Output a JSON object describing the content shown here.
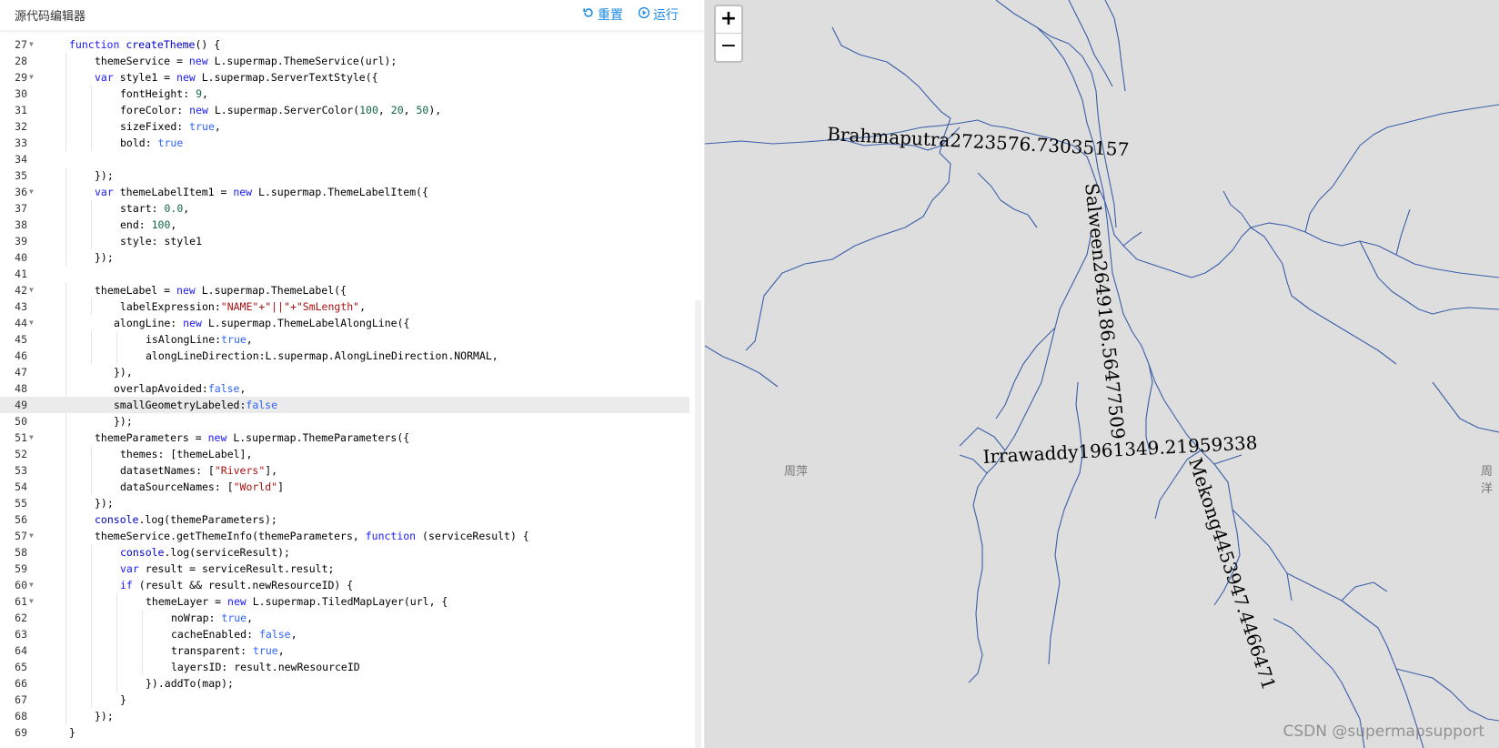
{
  "editor": {
    "title": "源代码编辑器",
    "reset_label": "重置",
    "run_label": "运行",
    "active_line": 49,
    "lines": [
      {
        "n": "27",
        "fold": true,
        "indent": 1,
        "segs": [
          [
            "kw",
            "function "
          ],
          [
            "fn",
            "createTheme"
          ],
          [
            "",
            "() {"
          ]
        ]
      },
      {
        "n": "28",
        "fold": false,
        "indent": 2,
        "segs": [
          [
            "",
            "themeService = "
          ],
          [
            "kw",
            "new "
          ],
          [
            "",
            "L.supermap.ThemeService(url);"
          ]
        ]
      },
      {
        "n": "29",
        "fold": true,
        "indent": 2,
        "segs": [
          [
            "kw",
            "var "
          ],
          [
            "",
            "style1 = "
          ],
          [
            "kw",
            "new "
          ],
          [
            "",
            "L.supermap.ServerTextStyle({"
          ]
        ]
      },
      {
        "n": "30",
        "fold": false,
        "indent": 3,
        "segs": [
          [
            "",
            "fontHeight: "
          ],
          [
            "num",
            "9"
          ],
          [
            "",
            ","
          ]
        ]
      },
      {
        "n": "31",
        "fold": false,
        "indent": 3,
        "segs": [
          [
            "",
            "foreColor: "
          ],
          [
            "kw",
            "new "
          ],
          [
            "",
            "L.supermap.ServerColor("
          ],
          [
            "num",
            "100"
          ],
          [
            "",
            ", "
          ],
          [
            "num",
            "20"
          ],
          [
            "",
            ", "
          ],
          [
            "num",
            "50"
          ],
          [
            "",
            "),"
          ]
        ]
      },
      {
        "n": "32",
        "fold": false,
        "indent": 3,
        "segs": [
          [
            "",
            "sizeFixed: "
          ],
          [
            "lit",
            "true"
          ],
          [
            "",
            ","
          ]
        ]
      },
      {
        "n": "33",
        "fold": false,
        "indent": 3,
        "segs": [
          [
            "",
            "bold: "
          ],
          [
            "lit",
            "true"
          ]
        ]
      },
      {
        "n": "34",
        "fold": false,
        "indent": 0,
        "segs": []
      },
      {
        "n": "35",
        "fold": false,
        "indent": 2,
        "segs": [
          [
            "",
            "});"
          ]
        ]
      },
      {
        "n": "36",
        "fold": true,
        "indent": 2,
        "segs": [
          [
            "kw",
            "var "
          ],
          [
            "",
            "themeLabelItem1 = "
          ],
          [
            "kw",
            "new "
          ],
          [
            "",
            "L.supermap.ThemeLabelItem({"
          ]
        ]
      },
      {
        "n": "37",
        "fold": false,
        "indent": 3,
        "segs": [
          [
            "",
            "start: "
          ],
          [
            "num",
            "0.0"
          ],
          [
            "",
            ","
          ]
        ]
      },
      {
        "n": "38",
        "fold": false,
        "indent": 3,
        "segs": [
          [
            "",
            "end: "
          ],
          [
            "num",
            "100"
          ],
          [
            "",
            ","
          ]
        ]
      },
      {
        "n": "39",
        "fold": false,
        "indent": 3,
        "segs": [
          [
            "",
            "style: style1"
          ]
        ]
      },
      {
        "n": "40",
        "fold": false,
        "indent": 2,
        "segs": [
          [
            "",
            "});"
          ]
        ]
      },
      {
        "n": "41",
        "fold": false,
        "indent": 0,
        "segs": []
      },
      {
        "n": "42",
        "fold": true,
        "indent": 2,
        "segs": [
          [
            "",
            "themeLabel = "
          ],
          [
            "kw",
            "new "
          ],
          [
            "",
            "L.supermap.ThemeLabel({"
          ]
        ]
      },
      {
        "n": "43",
        "fold": false,
        "indent": 3,
        "segs": [
          [
            "",
            "labelExpression:"
          ],
          [
            "str",
            "\"NAME\"+\"||\"+\"SmLength\""
          ],
          [
            "",
            ","
          ]
        ]
      },
      {
        "n": "44",
        "fold": true,
        "indent": 2.75,
        "segs": [
          [
            "",
            "alongLine: "
          ],
          [
            "kw",
            "new "
          ],
          [
            "",
            "L.supermap.ThemeLabelAlongLine({"
          ]
        ]
      },
      {
        "n": "45",
        "fold": false,
        "indent": 4,
        "segs": [
          [
            "",
            "isAlongLine:"
          ],
          [
            "lit",
            "true"
          ],
          [
            "",
            ","
          ]
        ]
      },
      {
        "n": "46",
        "fold": false,
        "indent": 4,
        "segs": [
          [
            "",
            "alongLineDirection:L.supermap.AlongLineDirection.NORMAL,"
          ]
        ]
      },
      {
        "n": "47",
        "fold": false,
        "indent": 2.75,
        "segs": [
          [
            "",
            "}),"
          ]
        ]
      },
      {
        "n": "48",
        "fold": false,
        "indent": 2.75,
        "segs": [
          [
            "",
            "overlapAvoided:"
          ],
          [
            "lit",
            "false"
          ],
          [
            "",
            ","
          ]
        ]
      },
      {
        "n": "49",
        "fold": false,
        "indent": 2.75,
        "segs": [
          [
            "",
            "smallGeometryLabeled:"
          ],
          [
            "lit",
            "false"
          ]
        ]
      },
      {
        "n": "50",
        "fold": false,
        "indent": 2.75,
        "segs": [
          [
            "",
            "});"
          ]
        ]
      },
      {
        "n": "51",
        "fold": true,
        "indent": 2,
        "segs": [
          [
            "",
            "themeParameters = "
          ],
          [
            "kw",
            "new "
          ],
          [
            "",
            "L.supermap.ThemeParameters({"
          ]
        ]
      },
      {
        "n": "52",
        "fold": false,
        "indent": 3,
        "segs": [
          [
            "",
            "themes: [themeLabel],"
          ]
        ]
      },
      {
        "n": "53",
        "fold": false,
        "indent": 3,
        "segs": [
          [
            "",
            "datasetNames: ["
          ],
          [
            "str",
            "\"Rivers\""
          ],
          [
            "",
            "],"
          ]
        ]
      },
      {
        "n": "54",
        "fold": false,
        "indent": 3,
        "segs": [
          [
            "",
            "dataSourceNames: ["
          ],
          [
            "str",
            "\"World\""
          ],
          [
            "",
            "]"
          ]
        ]
      },
      {
        "n": "55",
        "fold": false,
        "indent": 2,
        "segs": [
          [
            "",
            "});"
          ]
        ]
      },
      {
        "n": "56",
        "fold": false,
        "indent": 2,
        "segs": [
          [
            "fn",
            "console"
          ],
          [
            "",
            ".log(themeParameters);"
          ]
        ]
      },
      {
        "n": "57",
        "fold": true,
        "indent": 2,
        "segs": [
          [
            "",
            "themeService.getThemeInfo(themeParameters, "
          ],
          [
            "kw",
            "function "
          ],
          [
            "",
            "(serviceResult) {"
          ]
        ]
      },
      {
        "n": "58",
        "fold": false,
        "indent": 3,
        "segs": [
          [
            "fn",
            "console"
          ],
          [
            "",
            ".log(serviceResult);"
          ]
        ]
      },
      {
        "n": "59",
        "fold": false,
        "indent": 3,
        "segs": [
          [
            "kw",
            "var "
          ],
          [
            "",
            "result = serviceResult.result;"
          ]
        ]
      },
      {
        "n": "60",
        "fold": true,
        "indent": 3,
        "segs": [
          [
            "kw",
            "if "
          ],
          [
            "",
            "(result && result.newResourceID) {"
          ]
        ]
      },
      {
        "n": "61",
        "fold": true,
        "indent": 4,
        "segs": [
          [
            "",
            "themeLayer = "
          ],
          [
            "kw",
            "new "
          ],
          [
            "",
            "L.supermap.TiledMapLayer(url, {"
          ]
        ]
      },
      {
        "n": "62",
        "fold": false,
        "indent": 5,
        "segs": [
          [
            "",
            "noWrap: "
          ],
          [
            "lit",
            "true"
          ],
          [
            "",
            ","
          ]
        ]
      },
      {
        "n": "63",
        "fold": false,
        "indent": 5,
        "segs": [
          [
            "",
            "cacheEnabled: "
          ],
          [
            "lit",
            "false"
          ],
          [
            "",
            ","
          ]
        ]
      },
      {
        "n": "64",
        "fold": false,
        "indent": 5,
        "segs": [
          [
            "",
            "transparent: "
          ],
          [
            "lit",
            "true"
          ],
          [
            "",
            ","
          ]
        ]
      },
      {
        "n": "65",
        "fold": false,
        "indent": 5,
        "segs": [
          [
            "",
            "layersID: result.newResourceID"
          ]
        ]
      },
      {
        "n": "66",
        "fold": false,
        "indent": 4,
        "segs": [
          [
            "",
            "}).addTo(map);"
          ]
        ]
      },
      {
        "n": "67",
        "fold": false,
        "indent": 3,
        "segs": [
          [
            "",
            "}"
          ]
        ]
      },
      {
        "n": "68",
        "fold": false,
        "indent": 2,
        "segs": [
          [
            "",
            "});"
          ]
        ]
      },
      {
        "n": "69",
        "fold": false,
        "indent": 1,
        "segs": [
          [
            "",
            "}"
          ]
        ]
      }
    ]
  },
  "map": {
    "zoom_in": "+",
    "zoom_out": "−",
    "background_color": "#dedede",
    "river_color": "#3a5fa8",
    "labels": {
      "brahmaputra": "Brahmaputra2723576.73035157",
      "salween": "Salween2649186.56477509",
      "irrawaddy": "Irrawaddy1961349.21959338",
      "mekong": "Mekong4453947.4466471"
    },
    "places": [
      "周萍",
      "周洋"
    ],
    "watermark": "CSDN @supermapsupport"
  }
}
